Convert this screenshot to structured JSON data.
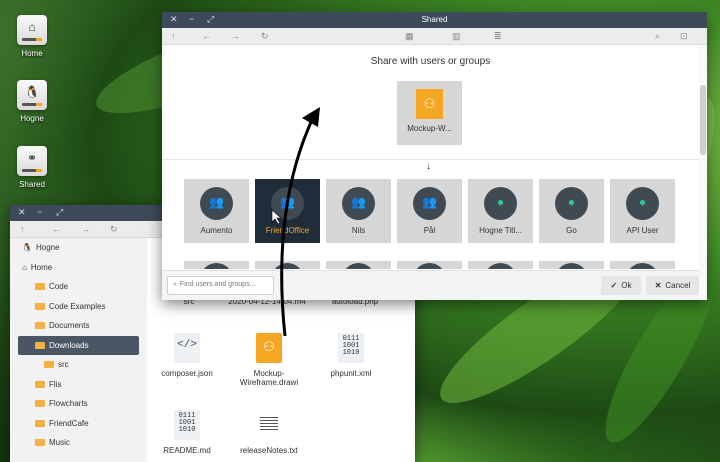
{
  "desktop": {
    "icons": [
      {
        "label": "Home",
        "glyph": "⌂"
      },
      {
        "label": "Hogne",
        "glyph": "🐧"
      },
      {
        "label": "Shared",
        "glyph": "⚭"
      }
    ]
  },
  "file_manager": {
    "sidebar": [
      {
        "label": "Hogne",
        "kind": "user"
      },
      {
        "label": "Home",
        "kind": "home"
      },
      {
        "label": "Code",
        "kind": "folder"
      },
      {
        "label": "Code Examples",
        "kind": "folder"
      },
      {
        "label": "Documents",
        "kind": "folder"
      },
      {
        "label": "Downloads",
        "kind": "folder",
        "active": true
      },
      {
        "label": "src",
        "kind": "subfolder"
      },
      {
        "label": "Flis",
        "kind": "folder"
      },
      {
        "label": "Flowcharts",
        "kind": "folder"
      },
      {
        "label": "FriendCafe",
        "kind": "folder"
      },
      {
        "label": "Music",
        "kind": "folder"
      }
    ],
    "files": [
      {
        "label": "src"
      },
      {
        "label": "2020-04-12-14-04.m4"
      },
      {
        "label": "autoload.php"
      },
      {
        "label": "composer.json",
        "icon": "</>"
      },
      {
        "label": "Mockup-Wireframe.drawi",
        "icon": "⚇"
      },
      {
        "label": "phpunit.xml",
        "icon": "0111\n1001\n1010"
      },
      {
        "label": "README.md",
        "icon": "0111\n1001\n1010"
      },
      {
        "label": "releaseNotes.txt"
      }
    ]
  },
  "share_dialog": {
    "title": "Shared",
    "heading": "Share with users or groups",
    "source_item": "Mockup-W...",
    "groups": [
      {
        "label": "Aumento",
        "kind": "group"
      },
      {
        "label": "FriendOffice",
        "kind": "group",
        "selected": true
      },
      {
        "label": "Nils",
        "kind": "group"
      },
      {
        "label": "Pål",
        "kind": "group"
      },
      {
        "label": "Hogne Titl...",
        "kind": "user"
      },
      {
        "label": "Go",
        "kind": "user"
      },
      {
        "label": "API User",
        "kind": "user"
      }
    ],
    "search_placeholder": "Find users and groups...",
    "ok_label": "Ok",
    "cancel_label": "Cancel"
  }
}
